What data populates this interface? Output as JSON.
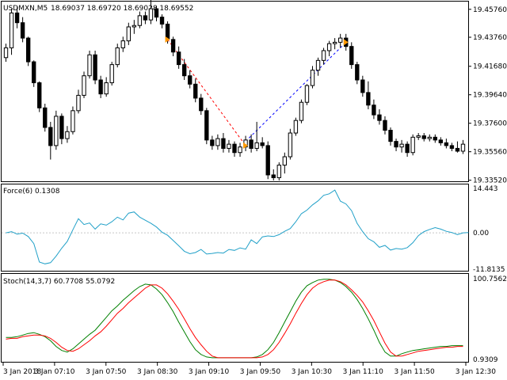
{
  "header": {
    "symbol": "USDMXN,M5",
    "ohlc": "18.69037 18.69720 18.69028 18.69552"
  },
  "force_panel": {
    "label": "Force(6) 0.1308"
  },
  "stoch_panel": {
    "label": "Stoch(14,3,7) 60.7708 55.0792"
  },
  "colors": {
    "background": "#ffffff",
    "candle_up_fill": "#ffffff",
    "candle_down_fill": "#000000",
    "candle_outline": "#000000",
    "force_line": "#20a0c8",
    "stoch_main": "#008000",
    "stoch_signal": "#ff0000",
    "trend_down": "#ff0000",
    "trend_up": "#0000ff",
    "arrow_marker": "#ff9900"
  },
  "chart_data": [
    {
      "type": "candlestick",
      "name": "price",
      "ylim": [
        19.335,
        19.462
      ],
      "y_ticks": [
        "19.45760",
        "19.43760",
        "19.41680",
        "19.39640",
        "19.37600",
        "19.35560",
        "19.33520"
      ],
      "x_ticks": [
        "3 Jan 2018",
        "3 Jan 07:10",
        "3 Jan 07:50",
        "3 Jan 08:30",
        "3 Jan 09:10",
        "3 Jan 09:50",
        "3 Jan 10:30",
        "3 Jan 11:10",
        "3 Jan 11:50",
        "3 Jan 12:30"
      ],
      "candles": [
        [
          19.423,
          19.433,
          19.42,
          19.43
        ],
        [
          19.43,
          19.458,
          19.425,
          19.455
        ],
        [
          19.455,
          19.459,
          19.444,
          19.448
        ],
        [
          19.448,
          19.452,
          19.434,
          19.437
        ],
        [
          19.437,
          19.438,
          19.417,
          19.42
        ],
        [
          19.42,
          19.421,
          19.402,
          19.405
        ],
        [
          19.405,
          19.406,
          19.384,
          19.387
        ],
        [
          19.387,
          19.39,
          19.37,
          19.373
        ],
        [
          19.373,
          19.377,
          19.35,
          19.36
        ],
        [
          19.36,
          19.385,
          19.357,
          19.381
        ],
        [
          19.381,
          19.383,
          19.361,
          19.365
        ],
        [
          19.365,
          19.374,
          19.362,
          19.37
        ],
        [
          19.37,
          19.388,
          19.368,
          19.385
        ],
        [
          19.385,
          19.4,
          19.383,
          19.396
        ],
        [
          19.396,
          19.413,
          19.394,
          19.41
        ],
        [
          19.41,
          19.428,
          19.408,
          19.425
        ],
        [
          19.425,
          19.428,
          19.404,
          19.407
        ],
        [
          19.407,
          19.41,
          19.394,
          19.397
        ],
        [
          19.397,
          19.409,
          19.395,
          19.405
        ],
        [
          19.405,
          19.42,
          19.403,
          19.418
        ],
        [
          19.418,
          19.433,
          19.416,
          19.43
        ],
        [
          19.43,
          19.438,
          19.427,
          19.435
        ],
        [
          19.435,
          19.448,
          19.432,
          19.445
        ],
        [
          19.445,
          19.45,
          19.44,
          19.446
        ],
        [
          19.446,
          19.456,
          19.444,
          19.453
        ],
        [
          19.453,
          19.456,
          19.447,
          19.45
        ],
        [
          19.45,
          19.467,
          19.447,
          19.458
        ],
        [
          19.458,
          19.46,
          19.449,
          19.452
        ],
        [
          19.452,
          19.454,
          19.444,
          19.447
        ],
        [
          19.447,
          19.449,
          19.433,
          19.436
        ],
        [
          19.436,
          19.438,
          19.424,
          19.427
        ],
        [
          19.427,
          19.431,
          19.415,
          19.418
        ],
        [
          19.418,
          19.422,
          19.407,
          19.41
        ],
        [
          19.41,
          19.414,
          19.401,
          19.404
        ],
        [
          19.404,
          19.408,
          19.391,
          19.394
        ],
        [
          19.394,
          19.397,
          19.382,
          19.385
        ],
        [
          19.385,
          19.387,
          19.361,
          19.364
        ],
        [
          19.364,
          19.367,
          19.357,
          19.36
        ],
        [
          19.36,
          19.368,
          19.357,
          19.365
        ],
        [
          19.365,
          19.369,
          19.355,
          19.358
        ],
        [
          19.358,
          19.364,
          19.355,
          19.361
        ],
        [
          19.361,
          19.363,
          19.352,
          19.355
        ],
        [
          19.355,
          19.362,
          19.352,
          19.359
        ],
        [
          19.359,
          19.367,
          19.356,
          19.364
        ],
        [
          19.364,
          19.368,
          19.355,
          19.358
        ],
        [
          19.358,
          19.377,
          19.356,
          19.362
        ],
        [
          19.362,
          19.366,
          19.358,
          19.36
        ],
        [
          19.36,
          19.363,
          19.336,
          19.339
        ],
        [
          19.339,
          19.343,
          19.335,
          19.337
        ],
        [
          19.337,
          19.348,
          19.335,
          19.346
        ],
        [
          19.346,
          19.355,
          19.34,
          19.352
        ],
        [
          19.352,
          19.372,
          19.35,
          19.369
        ],
        [
          19.369,
          19.38,
          19.367,
          19.378
        ],
        [
          19.378,
          19.393,
          19.376,
          19.391
        ],
        [
          19.391,
          19.404,
          19.389,
          19.403
        ],
        [
          19.403,
          19.417,
          19.401,
          19.414
        ],
        [
          19.414,
          19.423,
          19.41,
          19.421
        ],
        [
          19.421,
          19.43,
          19.418,
          19.428
        ],
        [
          19.428,
          19.435,
          19.424,
          19.433
        ],
        [
          19.433,
          19.437,
          19.429,
          19.434
        ],
        [
          19.434,
          19.44,
          19.43,
          19.437
        ],
        [
          19.437,
          19.44,
          19.428,
          19.431
        ],
        [
          19.431,
          19.434,
          19.415,
          19.418
        ],
        [
          19.418,
          19.42,
          19.404,
          19.407
        ],
        [
          19.407,
          19.41,
          19.395,
          19.398
        ],
        [
          19.398,
          19.406,
          19.386,
          19.389
        ],
        [
          19.389,
          19.393,
          19.379,
          19.382
        ],
        [
          19.382,
          19.386,
          19.375,
          19.378
        ],
        [
          19.378,
          19.381,
          19.368,
          19.371
        ],
        [
          19.371,
          19.373,
          19.36,
          19.363
        ],
        [
          19.363,
          19.365,
          19.356,
          19.359
        ],
        [
          19.359,
          19.364,
          19.355,
          19.361
        ],
        [
          19.361,
          19.363,
          19.352,
          19.355
        ],
        [
          19.355,
          19.368,
          19.353,
          19.366
        ],
        [
          19.366,
          19.369,
          19.364,
          19.367
        ],
        [
          19.367,
          19.369,
          19.363,
          19.365
        ],
        [
          19.365,
          19.368,
          19.363,
          19.366
        ],
        [
          19.366,
          19.368,
          19.362,
          19.364
        ],
        [
          19.364,
          19.366,
          19.36,
          19.362
        ],
        [
          19.362,
          19.365,
          19.358,
          19.36
        ],
        [
          19.36,
          19.362,
          19.356,
          19.358
        ],
        [
          19.358,
          19.363,
          19.355,
          19.356
        ],
        [
          19.356,
          19.364,
          19.354,
          19.361
        ]
      ],
      "trend_lines": [
        {
          "from": {
            "candle": 29,
            "value": 19.436
          },
          "to": {
            "candle": 43,
            "value": 19.36
          },
          "style": "down"
        },
        {
          "from": {
            "candle": 43,
            "value": 19.363
          },
          "to": {
            "candle": 61,
            "value": 19.434
          },
          "style": "up"
        }
      ],
      "arrow_markers": [
        {
          "candle": 29,
          "value": 19.436
        },
        {
          "candle": 43,
          "value": 19.36
        },
        {
          "candle": 61,
          "value": 19.434
        }
      ]
    },
    {
      "type": "line",
      "name": "Force(6)",
      "ylim": [
        -11.8135,
        14.443
      ],
      "y_ticks": [
        "14.443",
        "0.00",
        "-11.8135"
      ],
      "values": [
        0.0,
        0.4,
        -0.4,
        -0.1,
        -1.2,
        -3.5,
        -9.5,
        -10.1,
        -9.7,
        -7.6,
        -5.0,
        -2.8,
        1.0,
        4.6,
        2.7,
        3.2,
        1.2,
        2.9,
        2.5,
        3.6,
        5.1,
        4.2,
        6.4,
        6.8,
        5.1,
        4.1,
        3.1,
        1.9,
        0.2,
        -0.8,
        -2.5,
        -4.2,
        -6.0,
        -6.8,
        -6.4,
        -5.4,
        -6.9,
        -6.7,
        -6.4,
        -6.6,
        -5.4,
        -5.7,
        -4.9,
        -5.3,
        -2.3,
        -3.5,
        -1.3,
        -1.0,
        -1.2,
        -0.6,
        0.5,
        1.4,
        3.6,
        6.2,
        7.4,
        9.1,
        10.4,
        12.2,
        12.7,
        13.9,
        10.3,
        9.4,
        7.2,
        3.1,
        0.4,
        -1.9,
        -2.9,
        -4.7,
        -4.1,
        -5.6,
        -5.1,
        -5.3,
        -4.8,
        -3.2,
        -0.9,
        0.4,
        1.1,
        1.7,
        1.2,
        0.5,
        0.1,
        -0.6,
        0.0,
        0.1
      ],
      "zero_line": true
    },
    {
      "type": "line",
      "name": "Stoch(14,3,7)",
      "ylim": [
        0.9309,
        100.7562
      ],
      "y_ticks": [
        "100.7562",
        "0.9309"
      ],
      "series": [
        {
          "values": [
            28,
            28,
            29,
            31,
            33,
            34,
            32,
            29,
            24,
            17,
            12,
            10,
            14,
            20,
            26,
            32,
            37,
            45,
            53,
            61,
            67,
            74,
            80,
            86,
            91,
            94,
            93,
            88,
            81,
            71,
            60,
            47,
            35,
            23,
            13,
            7,
            4,
            3,
            3,
            3,
            3,
            3,
            3,
            3,
            3,
            4,
            7,
            13,
            22,
            34,
            47,
            60,
            73,
            84,
            92,
            96,
            99,
            100,
            100,
            99,
            96,
            91,
            84,
            75,
            64,
            51,
            37,
            22,
            10,
            5,
            5,
            8,
            10,
            12,
            13,
            14,
            15,
            16,
            17,
            17,
            18,
            18,
            18
          ]
        },
        {
          "values": [
            26,
            27,
            27,
            29,
            30,
            31,
            31,
            30,
            27,
            22,
            16,
            12,
            11,
            14,
            19,
            24,
            30,
            35,
            42,
            50,
            58,
            64,
            71,
            77,
            83,
            89,
            93,
            93,
            89,
            82,
            73,
            63,
            51,
            39,
            28,
            19,
            11,
            5,
            3,
            3,
            3,
            3,
            3,
            3,
            3,
            3,
            4,
            7,
            13,
            22,
            33,
            45,
            58,
            70,
            81,
            89,
            94,
            97,
            99,
            99,
            97,
            93,
            87,
            80,
            72,
            61,
            49,
            35,
            21,
            10,
            5,
            5,
            7,
            9,
            11,
            12,
            13,
            14,
            15,
            16,
            16,
            17,
            17
          ]
        }
      ]
    }
  ]
}
